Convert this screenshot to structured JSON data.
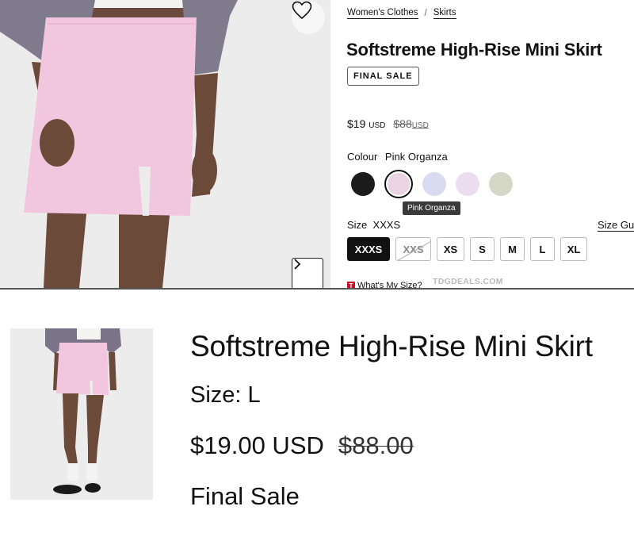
{
  "product_page": {
    "breadcrumbs": [
      "Women's Clothes",
      "Skirts"
    ],
    "breadcrumb_separator": "/",
    "title": "Softstreme High-Rise Mini Skirt",
    "badge": "FINAL SALE",
    "price": {
      "current": "$19",
      "current_currency": "USD",
      "original": "$88",
      "original_currency": "USD"
    },
    "colour_label": "Colour",
    "colour_selected": "Pink Organza",
    "swatches": [
      {
        "color": "#1c1c1c"
      },
      {
        "color": "#ecd3e2",
        "selected": true
      },
      {
        "color": "#d9dcf1"
      },
      {
        "color": "#ecdcef"
      },
      {
        "color": "#d5d8c7"
      }
    ],
    "tooltip": "Pink Organza",
    "size_label": "Size",
    "size_selected": "XXXS",
    "size_guide": "Size Gu",
    "sizes": [
      {
        "label": "XXXS",
        "state": "selected"
      },
      {
        "label": "XXS",
        "state": "unavailable"
      },
      {
        "label": "XS",
        "state": "available"
      },
      {
        "label": "S",
        "state": "available"
      },
      {
        "label": "M",
        "state": "available"
      },
      {
        "label": "L",
        "state": "available"
      },
      {
        "label": "XL",
        "state": "available"
      }
    ],
    "whats_my_size": "What's My Size?",
    "watermark": "TDGDEALS.COM",
    "icons": {
      "favorite": "heart-icon",
      "next": "chevron-right-icon",
      "size_tool": "t-logo-icon"
    }
  },
  "cart_item": {
    "title": "Softstreme High-Rise Mini Skirt",
    "size": "Size: L",
    "price": "$19.00 USD",
    "original_price": "$88.00",
    "note": "Final Sale"
  }
}
